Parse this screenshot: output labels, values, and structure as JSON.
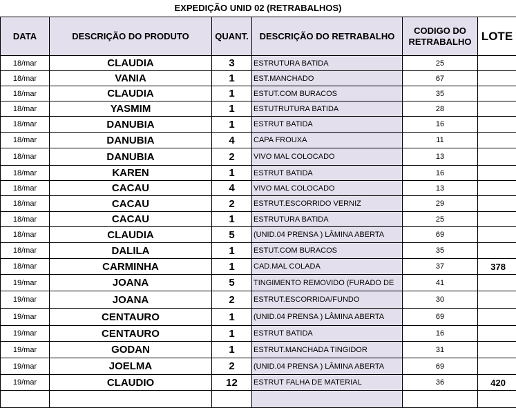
{
  "title": "EXPEDIÇÃO UNID 02 (RETRABALHOS)",
  "headers": {
    "data": "DATA",
    "produto": "DESCRIÇÃO DO PRODUTO",
    "quant": "QUANT.",
    "retrabalho": "DESCRIÇÃO DO RETRABALHO",
    "codigo": "CODIGO DO RETRABALHO",
    "lote": "LOTE"
  },
  "rows": [
    {
      "data": "18/mar",
      "produto": "CLAUDIA",
      "quant": "3",
      "retrabalho": "ESTRUTURA BATIDA",
      "codigo": "25",
      "lote": ""
    },
    {
      "data": "18/mar",
      "produto": "VANIA",
      "quant": "1",
      "retrabalho": "EST.MANCHADO",
      "codigo": "67",
      "lote": ""
    },
    {
      "data": "18/mar",
      "produto": "CLAUDIA",
      "quant": "1",
      "retrabalho": "ESTUT.COM BURACOS",
      "codigo": "35",
      "lote": ""
    },
    {
      "data": "18/mar",
      "produto": "YASMIM",
      "quant": "1",
      "retrabalho": "ESTUTRUTURA BATIDA",
      "codigo": "28",
      "lote": ""
    },
    {
      "data": "18/mar",
      "produto": "DANUBIA",
      "quant": "1",
      "retrabalho": "ESTRUT BATIDA",
      "codigo": "16",
      "lote": ""
    },
    {
      "data": "18/mar",
      "produto": "DANUBIA",
      "quant": "4",
      "retrabalho": "CAPA FROUXA",
      "codigo": "11",
      "lote": ""
    },
    {
      "data": "18/mar",
      "produto": "DANUBIA",
      "quant": "2",
      "retrabalho": "VIVO MAL COLOCADO",
      "codigo": "13",
      "lote": ""
    },
    {
      "data": "18/mar",
      "produto": "KAREN",
      "quant": "1",
      "retrabalho": "ESTRUT BATIDA",
      "codigo": "16",
      "lote": ""
    },
    {
      "data": "18/mar",
      "produto": "CACAU",
      "quant": "4",
      "retrabalho": "VIVO MAL COLOCADO",
      "codigo": "13",
      "lote": ""
    },
    {
      "data": "18/mar",
      "produto": "CACAU",
      "quant": "2",
      "retrabalho": "ESTRUT.ESCORRIDO VERNIZ",
      "codigo": "29",
      "lote": ""
    },
    {
      "data": "18/mar",
      "produto": "CACAU",
      "quant": "1",
      "retrabalho": "ESTRUTURA BATIDA",
      "codigo": "25",
      "lote": ""
    },
    {
      "data": "18/mar",
      "produto": "CLAUDIA",
      "quant": "5",
      "retrabalho": "(UNID.04 PRENSA ) LÂMINA ABERTA",
      "codigo": "69",
      "lote": ""
    },
    {
      "data": "18/mar",
      "produto": "DALILA",
      "quant": "1",
      "retrabalho": "ESTUT.COM BURACOS",
      "codigo": "35",
      "lote": ""
    },
    {
      "data": "18/mar",
      "produto": "CARMINHA",
      "quant": "1",
      "retrabalho": "CAD.MAL COLADA",
      "codigo": "37",
      "lote": "378"
    },
    {
      "data": "19/mar",
      "produto": "JOANA",
      "quant": "5",
      "retrabalho": "TINGIMENTO REMOVIDO (FURADO DE",
      "codigo": "41",
      "lote": ""
    },
    {
      "data": "19/mar",
      "produto": "JOANA",
      "quant": "2",
      "retrabalho": "ESTRUT.ESCORRIDA/FUNDO",
      "codigo": "30",
      "lote": ""
    },
    {
      "data": "19/mar",
      "produto": "CENTAURO",
      "quant": "1",
      "retrabalho": "(UNID.04 PRENSA ) LÂMINA ABERTA",
      "codigo": "69",
      "lote": ""
    },
    {
      "data": "19/mar",
      "produto": "CENTAURO",
      "quant": "1",
      "retrabalho": "ESTRUT BATIDA",
      "codigo": "16",
      "lote": ""
    },
    {
      "data": "19/mar",
      "produto": "GODAN",
      "quant": "1",
      "retrabalho": "ESTRUT.MANCHADA TINGIDOR",
      "codigo": "31",
      "lote": ""
    },
    {
      "data": "19/mar",
      "produto": "JOELMA",
      "quant": "2",
      "retrabalho": "(UNID.04 PRENSA ) LÂMINA ABERTA",
      "codigo": "69",
      "lote": ""
    },
    {
      "data": "19/mar",
      "produto": "CLAUDIO",
      "quant": "12",
      "retrabalho": "ESTRUT FALHA DE MATERIAL",
      "codigo": "36",
      "lote": "420"
    },
    {
      "data": "",
      "produto": "",
      "quant": "",
      "retrabalho": "",
      "codigo": "",
      "lote": ""
    }
  ]
}
